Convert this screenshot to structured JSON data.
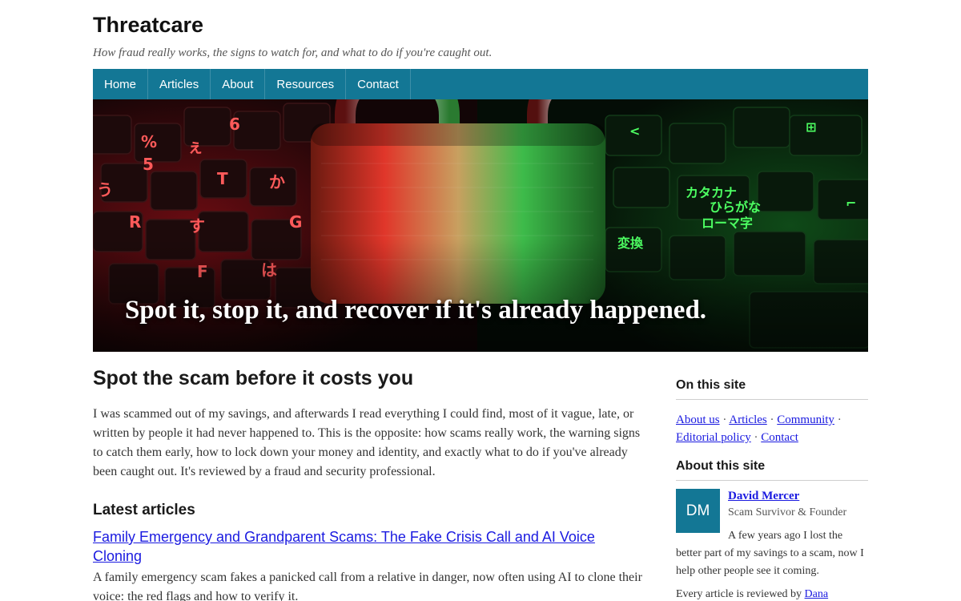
{
  "site": {
    "title": "Threatcare",
    "tagline": "How fraud really works, the signs to watch for, and what to do if you're caught out."
  },
  "nav": {
    "items": [
      {
        "label": "Home"
      },
      {
        "label": "Articles"
      },
      {
        "label": "About"
      },
      {
        "label": "Resources"
      },
      {
        "label": "Contact"
      }
    ]
  },
  "hero": {
    "caption": "Spot it, stop it, and recover if it's already happened.",
    "image_subject": "padlock-on-keyboard"
  },
  "main": {
    "heading": "Spot the scam before it costs you",
    "intro": "I was scammed out of my savings, and afterwards I read everything I could find, most of it vague, late, or written by people it had never happened to. This is the opposite: how scams really work, the warning signs to catch them early, how to lock down your money and identity, and exactly what to do if you've already been caught out. It's reviewed by a fraud and security professional.",
    "latest_heading": "Latest articles",
    "articles": [
      {
        "title": "Family Emergency and Grandparent Scams: The Fake Crisis Call and AI Voice Cloning",
        "summary": "A family emergency scam fakes a panicked call from a relative in danger, now often using AI to clone their voice: the red flags and how to verify it."
      }
    ]
  },
  "sidebar": {
    "on_this_site_heading": "On this site",
    "links": [
      {
        "label": "About us"
      },
      {
        "label": "Articles"
      },
      {
        "label": "Community"
      },
      {
        "label": "Editorial policy"
      },
      {
        "label": "Contact"
      }
    ],
    "about_heading": "About this site",
    "author": {
      "initials": "DM",
      "name": "David Mercer",
      "role": "Scam Survivor & Founder",
      "bio": "A few years ago I lost the better part of my savings to a scam, now I help other people see it coming."
    },
    "reviewed_prefix": "Every article is reviewed by",
    "reviewer_link": "Dana"
  },
  "colors": {
    "accent": "#137795",
    "link": "#1a1ae0"
  }
}
